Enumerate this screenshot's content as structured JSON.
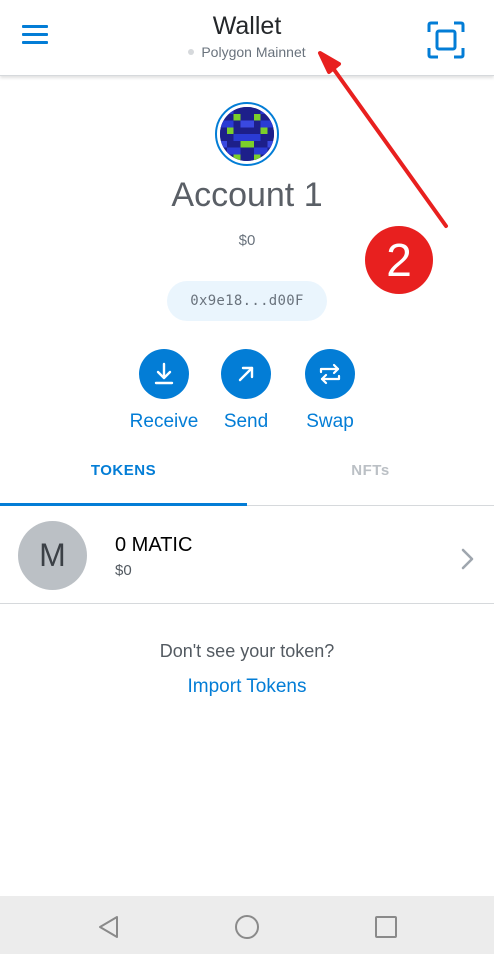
{
  "header": {
    "title": "Wallet",
    "network": "Polygon Mainnet",
    "menu_icon": "hamburger-menu-icon",
    "scan_icon": "qr-scan-icon"
  },
  "account": {
    "name": "Account 1",
    "balance": "$0",
    "address": "0x9e18...d00F",
    "avatar_icon": "identicon-avatar"
  },
  "actions": [
    {
      "label": "Receive",
      "icon": "download-arrow-icon"
    },
    {
      "label": "Send",
      "icon": "diagonal-arrow-icon"
    },
    {
      "label": "Swap",
      "icon": "swap-arrows-icon"
    }
  ],
  "tabs": [
    {
      "label": "TOKENS",
      "active": true
    },
    {
      "label": "NFTs",
      "active": false
    }
  ],
  "tokens": [
    {
      "initial": "M",
      "amount": "0 MATIC",
      "fiat": "$0"
    }
  ],
  "import": {
    "prompt": "Don't see your token?",
    "link": "Import Tokens"
  },
  "annotation": {
    "badge": "2",
    "color": "#e8201f"
  },
  "colors": {
    "accent": "#037dd6",
    "text": "#24272a",
    "muted": "#6a737d"
  },
  "navbar": {
    "icons": [
      "back-triangle-icon",
      "home-circle-icon",
      "recents-square-icon"
    ]
  }
}
